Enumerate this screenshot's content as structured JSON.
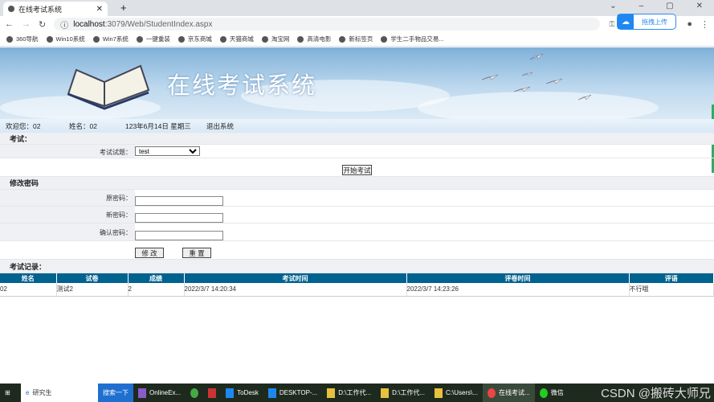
{
  "browser": {
    "tab_title": "在线考试系统",
    "url_host": "localhost",
    "url_rest": ":3079/Web/StudentIndex.aspx",
    "upload_label": "拖拽上传",
    "bookmarks": [
      "360导航",
      "Win10系统",
      "Win7系统",
      "一键重装",
      "京东商城",
      "天猫商城",
      "淘宝网",
      "高清电影",
      "新标签页",
      "学生二手物品交易..."
    ]
  },
  "banner": {
    "title": "在线考试系统"
  },
  "info": {
    "welcome": "欢迎您：02",
    "name": "姓名：02",
    "date": "123年6月14日 星期三",
    "logout": "退出系统"
  },
  "exam": {
    "header": "考试：",
    "label": "考试试题：",
    "selected": "test",
    "start": "开始考试"
  },
  "password": {
    "header": "修改密码",
    "old": "原密码：",
    "new": "新密码：",
    "confirm": "确认密码：",
    "modify": "修 改",
    "reset": "重 置"
  },
  "records": {
    "header": "考试记录：",
    "columns": [
      "姓名",
      "试卷",
      "成绩",
      "考试时间",
      "评卷时间",
      "评语"
    ],
    "rows": [
      [
        "02",
        "测试2",
        "2",
        "2022/3/7 14:20:34",
        "2022/3/7 14:23:26",
        "不行哦"
      ]
    ]
  },
  "taskbar": {
    "search": "研究生",
    "search_btn": "搜索一下",
    "apps": [
      "OnlineEx...",
      "ToDesk",
      "DESKTOP-...",
      "D:\\工作代...",
      "D:\\工作代...",
      "C:\\Users\\...",
      "在线考试...",
      "微信"
    ],
    "watermark": "CSDN @搬砖大师兄"
  }
}
